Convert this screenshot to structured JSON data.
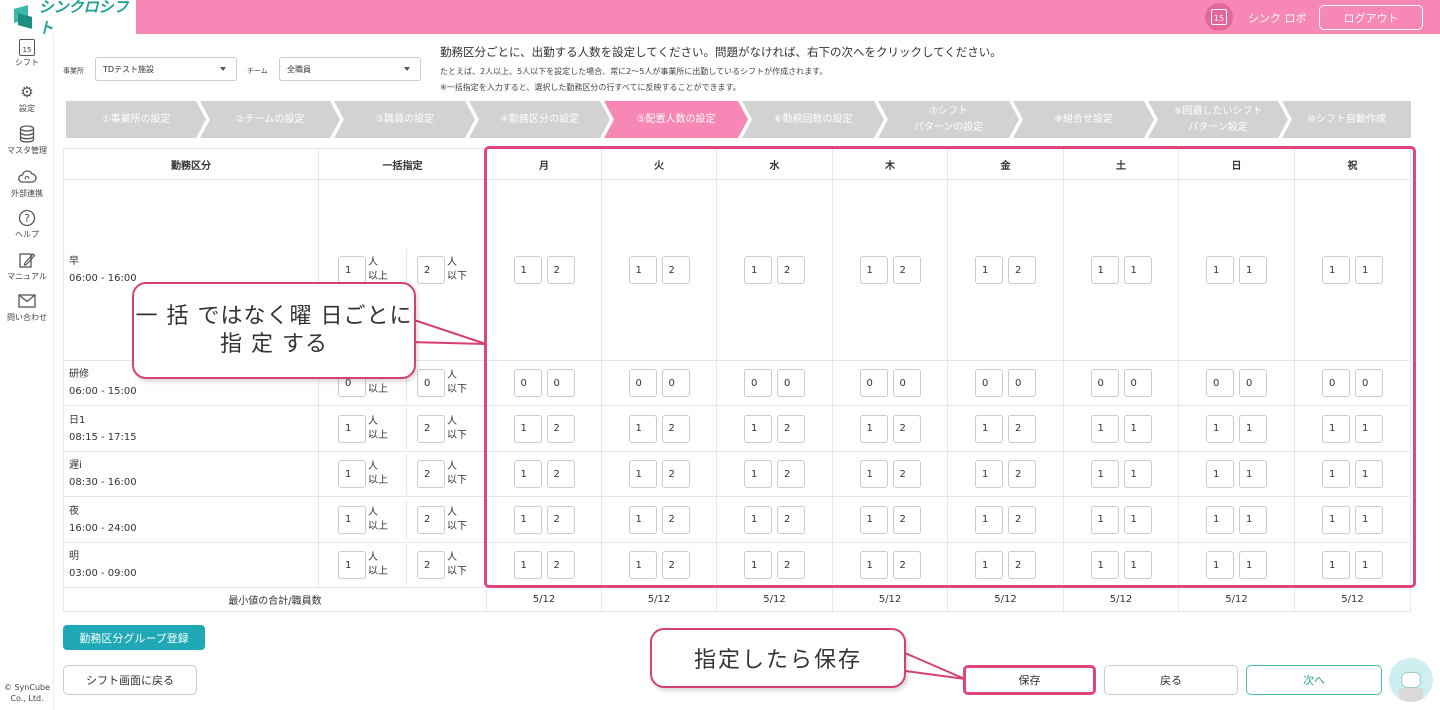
{
  "header": {
    "app_name": "シンクロシフト",
    "calendar_day": "15",
    "user_name": "シンク ロボ",
    "logout_label": "ログアウト"
  },
  "sidebar": {
    "items": [
      {
        "label": "シフト",
        "icon": "calendar-icon",
        "day": "15"
      },
      {
        "label": "設定",
        "icon": "gear-icon"
      },
      {
        "label": "マスタ管理",
        "icon": "database-icon"
      },
      {
        "label": "外部連携",
        "icon": "cloud-sync-icon"
      },
      {
        "label": "ヘルプ",
        "icon": "help-icon"
      },
      {
        "label": "マニュアル",
        "icon": "manual-icon"
      },
      {
        "label": "問い合わせ",
        "icon": "mail-icon"
      }
    ],
    "copyright_line1": "© SynCube",
    "copyright_line2": "Co., Ltd."
  },
  "filters": {
    "office_label": "事業所",
    "office_value": "TDテスト施設",
    "team_label": "チーム",
    "team_value": "全職員"
  },
  "instructions": {
    "line1": "勤務区分ごとに、出勤する人数を設定してください。問題がなければ、右下の次へをクリックしてください。",
    "line2": "たとえば、2人以上、5人以下を設定した場合、常に2〜5人が事業所に出勤しているシフトが作成されます。",
    "line3": "※一括指定を入力すると、選択した勤務区分の行すべてに反映することができます。"
  },
  "steps": [
    {
      "line1": "①事業所の設定",
      "line2": "",
      "active": false
    },
    {
      "line1": "②チームの設定",
      "line2": "",
      "active": false
    },
    {
      "line1": "③職員の設定",
      "line2": "",
      "active": false
    },
    {
      "line1": "④勤務区分の設定",
      "line2": "",
      "active": false
    },
    {
      "line1": "⑤配置人数の設定",
      "line2": "",
      "active": true
    },
    {
      "line1": "⑥勤務回数の設定",
      "line2": "",
      "active": false
    },
    {
      "line1": "⑦シフト",
      "line2": "パターンの設定",
      "active": false
    },
    {
      "line1": "⑧組合せ設定",
      "line2": "",
      "active": false
    },
    {
      "line1": "⑨回避したいシフト",
      "line2": "パターン設定",
      "active": false
    },
    {
      "line1": "⑩シフト自動作成",
      "line2": "",
      "active": false
    }
  ],
  "table": {
    "col_shift": "勤務区分",
    "col_bulk": "一括指定",
    "days": [
      "月",
      "火",
      "水",
      "木",
      "金",
      "土",
      "日",
      "祝"
    ],
    "unit_min_1": "人",
    "unit_min_2": "以上",
    "unit_max_1": "人",
    "unit_max_2": "以下",
    "rows": [
      {
        "name": "早",
        "time": "06:00 - 16:00",
        "bulk_min": "1",
        "bulk_max": "2",
        "values": [
          [
            "1",
            "2"
          ],
          [
            "1",
            "2"
          ],
          [
            "1",
            "2"
          ],
          [
            "1",
            "2"
          ],
          [
            "1",
            "2"
          ],
          [
            "1",
            "1"
          ],
          [
            "1",
            "1"
          ],
          [
            "1",
            "1"
          ]
        ]
      },
      {
        "name": "研修",
        "time": "06:00 - 15:00",
        "bulk_min": "0",
        "bulk_max": "0",
        "values": [
          [
            "0",
            "0"
          ],
          [
            "0",
            "0"
          ],
          [
            "0",
            "0"
          ],
          [
            "0",
            "0"
          ],
          [
            "0",
            "0"
          ],
          [
            "0",
            "0"
          ],
          [
            "0",
            "0"
          ],
          [
            "0",
            "0"
          ]
        ]
      },
      {
        "name": "日1",
        "time": "08:15 - 17:15",
        "bulk_min": "1",
        "bulk_max": "2",
        "values": [
          [
            "1",
            "2"
          ],
          [
            "1",
            "2"
          ],
          [
            "1",
            "2"
          ],
          [
            "1",
            "2"
          ],
          [
            "1",
            "2"
          ],
          [
            "1",
            "1"
          ],
          [
            "1",
            "1"
          ],
          [
            "1",
            "1"
          ]
        ]
      },
      {
        "name": "遅i",
        "time": "08:30 - 16:00",
        "bulk_min": "1",
        "bulk_max": "2",
        "values": [
          [
            "1",
            "2"
          ],
          [
            "1",
            "2"
          ],
          [
            "1",
            "2"
          ],
          [
            "1",
            "2"
          ],
          [
            "1",
            "2"
          ],
          [
            "1",
            "1"
          ],
          [
            "1",
            "1"
          ],
          [
            "1",
            "1"
          ]
        ]
      },
      {
        "name": "夜",
        "time": "16:00 - 24:00",
        "bulk_min": "1",
        "bulk_max": "2",
        "values": [
          [
            "1",
            "2"
          ],
          [
            "1",
            "2"
          ],
          [
            "1",
            "2"
          ],
          [
            "1",
            "2"
          ],
          [
            "1",
            "2"
          ],
          [
            "1",
            "1"
          ],
          [
            "1",
            "1"
          ],
          [
            "1",
            "1"
          ]
        ]
      },
      {
        "name": "明",
        "time": "03:00 - 09:00",
        "bulk_min": "1",
        "bulk_max": "2",
        "values": [
          [
            "1",
            "2"
          ],
          [
            "1",
            "2"
          ],
          [
            "1",
            "2"
          ],
          [
            "1",
            "2"
          ],
          [
            "1",
            "2"
          ],
          [
            "1",
            "1"
          ],
          [
            "1",
            "1"
          ],
          [
            "1",
            "1"
          ]
        ]
      }
    ],
    "summary_label": "最小値の合計/職員数",
    "summary_values": [
      "5/12",
      "5/12",
      "5/12",
      "5/12",
      "5/12",
      "5/12",
      "5/12",
      "5/12"
    ]
  },
  "callouts": {
    "callout1_line1": "一 括 ではなく曜 日ごとに",
    "callout1_line2": "指 定 する",
    "callout2": "指定したら保存"
  },
  "buttons": {
    "group_register": "勤務区分グループ登録",
    "back_to_shift": "シフト画面に戻る",
    "save": "保存",
    "back": "戻る",
    "next": "次へ"
  },
  "colors": {
    "brand_pink": "#f787b4",
    "accent_teal": "#1fa9b6",
    "highlight_red": "#e0457f",
    "step_inactive": "#d2d2d2"
  }
}
